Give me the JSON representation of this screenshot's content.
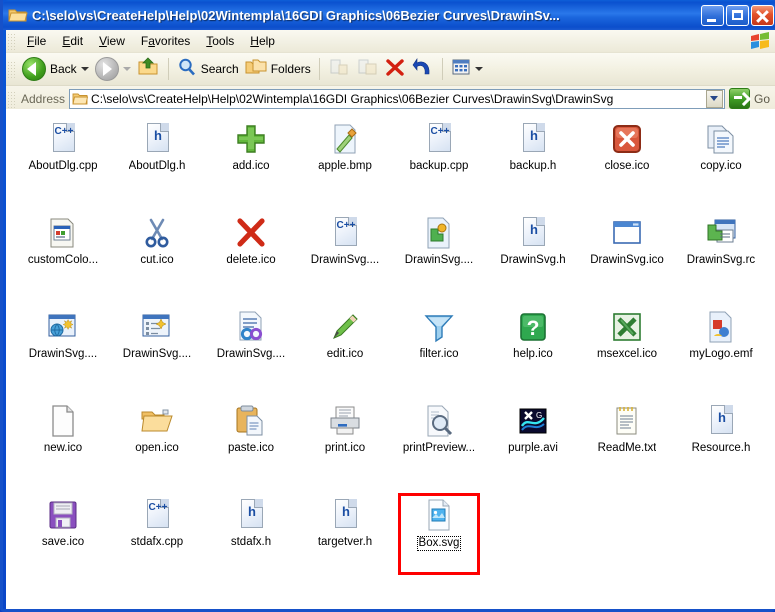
{
  "window": {
    "title": "C:\\selo\\vs\\CreateHelp\\Help\\02Wintempla\\16GDI Graphics\\06Bezier Curves\\DrawinSv...",
    "icon": "folder-icon",
    "minimize_label": "Minimize",
    "maximize_label": "Maximize",
    "close_label": "Close"
  },
  "menubar": {
    "items": [
      {
        "label": "File",
        "accel": "F"
      },
      {
        "label": "Edit",
        "accel": "E"
      },
      {
        "label": "View",
        "accel": "V"
      },
      {
        "label": "Favorites",
        "accel": "a"
      },
      {
        "label": "Tools",
        "accel": "T"
      },
      {
        "label": "Help",
        "accel": "H"
      }
    ],
    "branding_icon": "windows-flag-icon"
  },
  "toolbar": {
    "back_label": "Back",
    "back_icon": "back-arrow-icon",
    "forward_icon": "forward-arrow-icon",
    "up_icon": "up-folder-icon",
    "search_label": "Search",
    "search_icon": "magnifier-icon",
    "folders_label": "Folders",
    "folders_icon": "folders-icon",
    "move_to_icon": "move-to-folder-icon",
    "copy_to_icon": "copy-to-folder-icon",
    "delete_icon": "delete-x-icon",
    "undo_icon": "undo-arrow-icon",
    "views_icon": "views-icon"
  },
  "address": {
    "label": "Address",
    "icon": "folder-icon",
    "value": "C:\\selo\\vs\\CreateHelp\\Help\\02Wintempla\\16GDI Graphics\\06Bezier Curves\\DrawinSvg\\DrawinSvg",
    "placeholder": "Address",
    "dropdown_icon": "chevron-down-icon",
    "go_label": "Go",
    "go_icon": "go-arrow-icon"
  },
  "colors": {
    "titlebar_blue": "#0a51cf",
    "window_border": "#1651c9",
    "toolbar_beige": "#ece9d8",
    "highlight_red": "#fe0000",
    "file_pane_bg": "#ffffff"
  },
  "files": [
    {
      "name": "AboutDlg.cpp",
      "icon": "cpp-file-icon",
      "selected": false,
      "highlighted": false
    },
    {
      "name": "AboutDlg.h",
      "icon": "h-file-icon",
      "selected": false,
      "highlighted": false
    },
    {
      "name": "add.ico",
      "icon": "green-plus-icon",
      "selected": false,
      "highlighted": false
    },
    {
      "name": "apple.bmp",
      "icon": "paintbrush-image-icon",
      "selected": false,
      "highlighted": false
    },
    {
      "name": "backup.cpp",
      "icon": "cpp-file-icon",
      "selected": false,
      "highlighted": false
    },
    {
      "name": "backup.h",
      "icon": "h-file-icon",
      "selected": false,
      "highlighted": false
    },
    {
      "name": "close.ico",
      "icon": "red-close-icon",
      "selected": false,
      "highlighted": false
    },
    {
      "name": "copy.ico",
      "icon": "copy-pages-icon",
      "selected": false,
      "highlighted": false
    },
    {
      "name": "customColo...",
      "icon": "dialog-window-icon",
      "selected": false,
      "highlighted": false
    },
    {
      "name": "cut.ico",
      "icon": "scissors-icon",
      "selected": false,
      "highlighted": false
    },
    {
      "name": "delete.ico",
      "icon": "red-x-icon",
      "selected": false,
      "highlighted": false
    },
    {
      "name": "DrawinSvg....",
      "icon": "cpp-file-icon",
      "selected": false,
      "highlighted": false
    },
    {
      "name": "DrawinSvg....",
      "icon": "puzzle-file-icon",
      "selected": false,
      "highlighted": false
    },
    {
      "name": "DrawinSvg.h",
      "icon": "h-file-icon",
      "selected": false,
      "highlighted": false
    },
    {
      "name": "DrawinSvg.ico",
      "icon": "blank-window-icon",
      "selected": false,
      "highlighted": false
    },
    {
      "name": "DrawinSvg.rc",
      "icon": "resource-script-icon",
      "selected": false,
      "highlighted": false
    },
    {
      "name": "DrawinSvg....",
      "icon": "web-project-icon",
      "selected": false,
      "highlighted": false
    },
    {
      "name": "DrawinSvg....",
      "icon": "project-list-icon",
      "selected": false,
      "highlighted": false
    },
    {
      "name": "DrawinSvg....",
      "icon": "infinity-doc-icon",
      "selected": false,
      "highlighted": false
    },
    {
      "name": "edit.ico",
      "icon": "pencil-icon",
      "selected": false,
      "highlighted": false
    },
    {
      "name": "filter.ico",
      "icon": "funnel-icon",
      "selected": false,
      "highlighted": false
    },
    {
      "name": "help.ico",
      "icon": "green-question-icon",
      "selected": false,
      "highlighted": false
    },
    {
      "name": "msexcel.ico",
      "icon": "excel-icon",
      "selected": false,
      "highlighted": false
    },
    {
      "name": "myLogo.emf",
      "icon": "emf-image-icon",
      "selected": false,
      "highlighted": false
    },
    {
      "name": "new.ico",
      "icon": "blank-page-icon",
      "selected": false,
      "highlighted": false
    },
    {
      "name": "open.ico",
      "icon": "open-folder-icon",
      "selected": false,
      "highlighted": false
    },
    {
      "name": "paste.ico",
      "icon": "clipboard-paste-icon",
      "selected": false,
      "highlighted": false
    },
    {
      "name": "print.ico",
      "icon": "printer-icon",
      "selected": false,
      "highlighted": false
    },
    {
      "name": "printPreview...",
      "icon": "print-preview-icon",
      "selected": false,
      "highlighted": false
    },
    {
      "name": "purple.avi",
      "icon": "avi-video-icon",
      "selected": false,
      "highlighted": false
    },
    {
      "name": "ReadMe.txt",
      "icon": "notepad-text-icon",
      "selected": false,
      "highlighted": false
    },
    {
      "name": "Resource.h",
      "icon": "h-file-icon",
      "selected": false,
      "highlighted": false
    },
    {
      "name": "save.ico",
      "icon": "floppy-disk-icon",
      "selected": false,
      "highlighted": false
    },
    {
      "name": "stdafx.cpp",
      "icon": "cpp-file-icon",
      "selected": false,
      "highlighted": false
    },
    {
      "name": "stdafx.h",
      "icon": "h-file-icon",
      "selected": false,
      "highlighted": false
    },
    {
      "name": "targetver.h",
      "icon": "h-file-icon",
      "selected": false,
      "highlighted": false
    },
    {
      "name": "Box.svg",
      "icon": "svg-image-icon",
      "selected": true,
      "highlighted": true
    }
  ]
}
